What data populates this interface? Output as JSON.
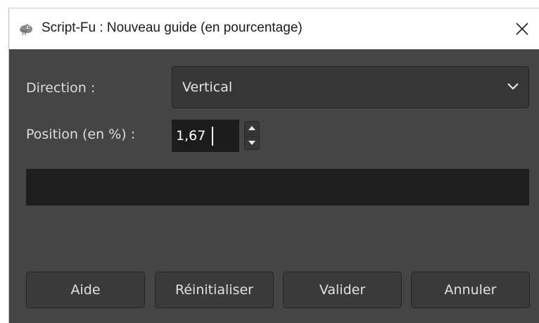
{
  "window": {
    "title": "Script-Fu : Nouveau guide (en pourcentage)"
  },
  "form": {
    "direction_label": "Direction :",
    "direction_value": "Vertical",
    "position_label": "Position (en %) :",
    "position_value": "1,67"
  },
  "buttons": {
    "help": "Aide",
    "reset": "Réinitialiser",
    "ok": "Valider",
    "cancel": "Annuler"
  },
  "icons": {
    "app": "gimp-icon",
    "close": "close-icon",
    "dropdown": "chevron-down-icon",
    "spin_up": "arrow-up-icon",
    "spin_down": "arrow-down-icon"
  },
  "colors": {
    "dialog_background": "#454545",
    "field_background": "#1c1c1c",
    "button_background": "#3a3a3a",
    "text": "#dcdcdc"
  }
}
